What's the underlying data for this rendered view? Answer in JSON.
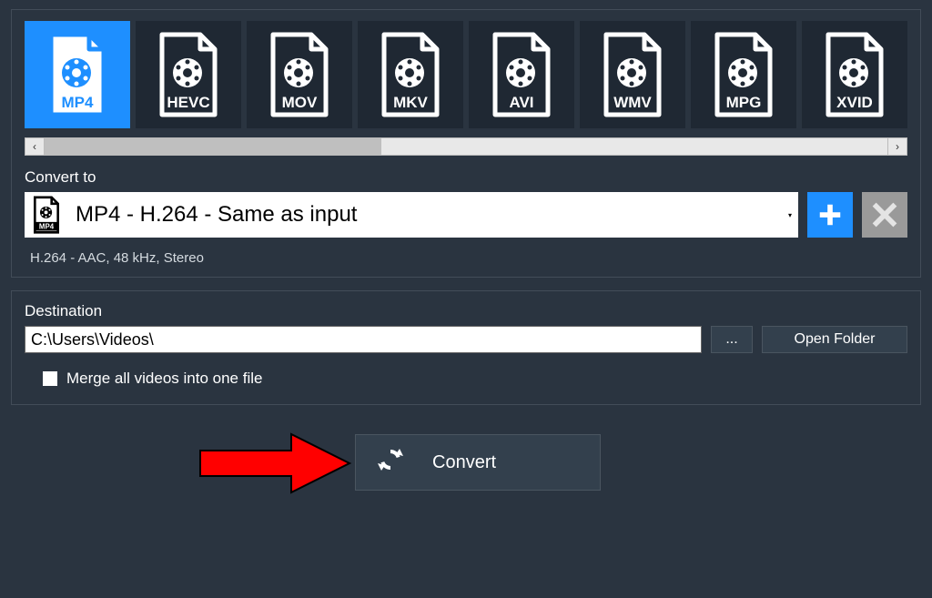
{
  "formats": [
    {
      "id": "mp4",
      "label": "MP4",
      "selected": true
    },
    {
      "id": "hevc",
      "label": "HEVC",
      "selected": false
    },
    {
      "id": "mov",
      "label": "MOV",
      "selected": false
    },
    {
      "id": "mkv",
      "label": "MKV",
      "selected": false
    },
    {
      "id": "avi",
      "label": "AVI",
      "selected": false
    },
    {
      "id": "wmv",
      "label": "WMV",
      "selected": false
    },
    {
      "id": "mpg",
      "label": "MPG",
      "selected": false
    },
    {
      "id": "xvid",
      "label": "XVID",
      "selected": false
    }
  ],
  "convert_to": {
    "label": "Convert to",
    "selected_format": "MP4",
    "selected_text": "MP4 - H.264 - Same as input",
    "codec_info": "H.264  -  AAC,  48 kHz,  Stereo"
  },
  "destination": {
    "label": "Destination",
    "path": "C:\\Users\\Videos\\",
    "browse_label": "...",
    "open_folder_label": "Open Folder",
    "merge_label": "Merge all videos into one file",
    "merge_checked": false
  },
  "actions": {
    "convert_label": "Convert"
  }
}
